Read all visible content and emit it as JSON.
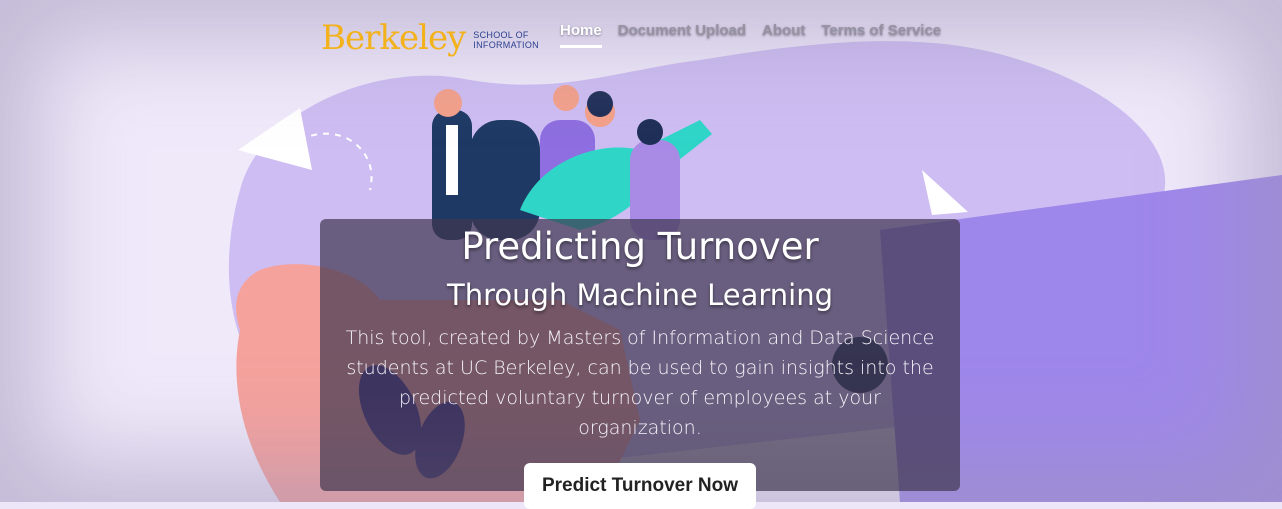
{
  "brand": {
    "wordmark": "Berkeley",
    "sub_line1": "SCHOOL OF",
    "sub_line2": "INFORMATION"
  },
  "nav": {
    "items": [
      {
        "label": "Home",
        "active": true
      },
      {
        "label": "Document Upload"
      },
      {
        "label": "About"
      },
      {
        "label": "Terms of Service"
      }
    ]
  },
  "hero": {
    "title": "Predicting Turnover",
    "subtitle": "Through Machine Learning",
    "description": "This tool, created by Masters of Information and Data Science students at UC Berkeley, can be used to gain insights into the predicted voluntary turnover of employees at your organization.",
    "cta_label": "Predict Turnover Now"
  },
  "illustration": {
    "icons": [
      "paper-plane-icon",
      "leaf-plant-icon",
      "hand-icon"
    ],
    "colors": {
      "purple_blob": "#c9b6f0",
      "purple_panel": "#9b86e8",
      "coral": "#f4a3a0",
      "teal": "#2fd6c8",
      "navy": "#1f2f57"
    }
  }
}
